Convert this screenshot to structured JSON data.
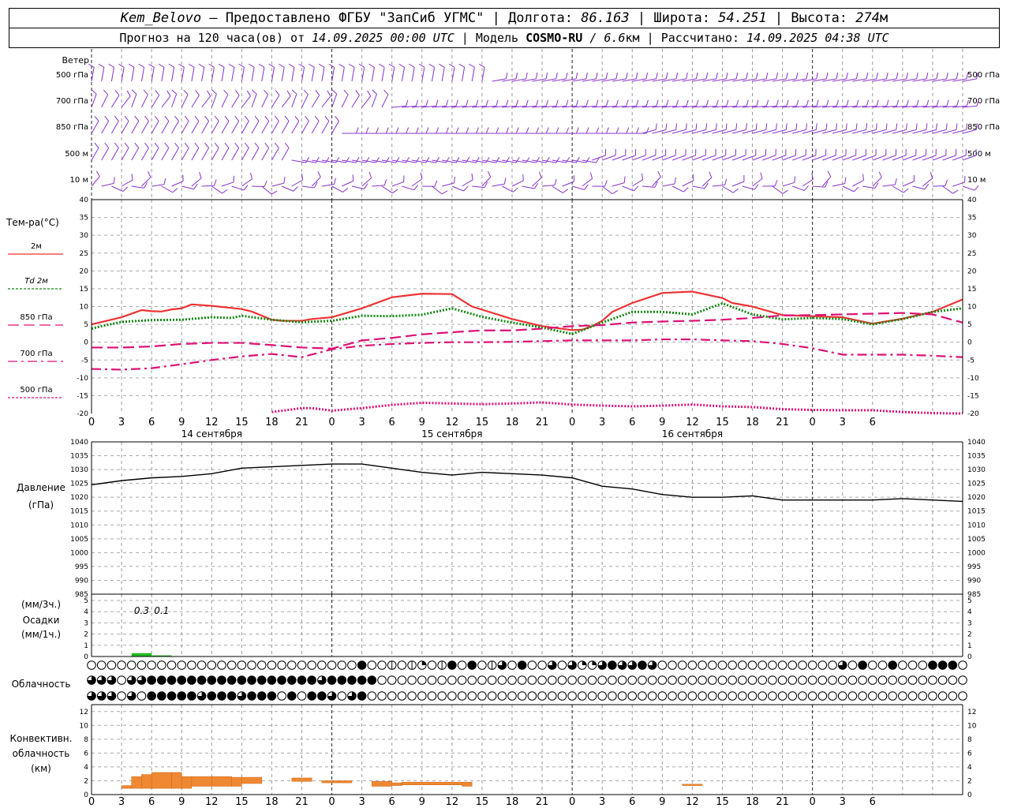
{
  "header": {
    "station": "Kem_Belovo",
    "provider": "– Предоставлено ФГБУ \"ЗапСиб УГМС\"",
    "lon_label": "Долгота:",
    "lon_value": "86.163",
    "lat_label": "Широта:",
    "lat_value": "54.251",
    "alt_label": "Высота:",
    "alt_value": "274",
    "alt_unit": "м",
    "forecast_label": "Прогноз на 120 часа(ов) от",
    "forecast_start": "14.09.2025 00:00 UTC",
    "model_label": "Модель",
    "model_name": "COSMO-RU",
    "model_res": "/ 6.6",
    "model_res_unit": "км",
    "calc_label": "Рассчитано:",
    "calc_time": "14.09.2025 04:38 UTC"
  },
  "chart_data": {
    "type": "meteogram",
    "x_hour_ticks": [
      "0",
      "3",
      "6",
      "9",
      "12",
      "15",
      "18",
      "21",
      "0",
      "3",
      "6",
      "9",
      "12",
      "15",
      "18",
      "21",
      "0",
      "3",
      "6",
      "9",
      "12",
      "15",
      "18",
      "21",
      "0",
      "3",
      "6"
    ],
    "date_labels": [
      "14 сентября",
      "15 сентября",
      "16 сентября"
    ],
    "wind": {
      "label": "Ветер",
      "levels": [
        "500 гПа",
        "700 гПа",
        "850 гПа",
        "500 м",
        "10 м"
      ]
    },
    "temperature": {
      "label": "Тем-ра(°C)",
      "ylim": [
        -20,
        40
      ],
      "yticks": [
        "40",
        "35",
        "30",
        "25",
        "20",
        "15",
        "10",
        "5",
        "0",
        "-5",
        "-10",
        "-15",
        "-20"
      ],
      "series": [
        {
          "name": "2м",
          "color": "#ee3333",
          "style": "solid",
          "x": [
            0,
            3,
            4,
            5,
            6,
            7,
            8,
            9,
            10,
            11,
            12,
            14,
            15,
            16,
            18,
            19,
            20,
            21,
            22,
            24,
            27,
            30,
            33,
            36,
            38,
            42,
            45,
            48,
            49,
            50,
            51,
            52,
            54,
            57,
            60,
            63,
            64,
            66,
            69,
            72,
            75,
            78,
            81,
            84,
            87
          ],
          "values": [
            5,
            7,
            8,
            9,
            8.7,
            8.6,
            9.2,
            9.5,
            10.6,
            10.4,
            10.2,
            9.6,
            9.3,
            8.6,
            6.3,
            6,
            6,
            6,
            6.5,
            7,
            9.5,
            12.6,
            13.6,
            13.5,
            10,
            6.5,
            4.5,
            3.4,
            3.5,
            4.5,
            6,
            8.5,
            11,
            13.8,
            14.2,
            12.4,
            11,
            10,
            7.6,
            7.3,
            7,
            5.2,
            6.6,
            8.5,
            12
          ]
        },
        {
          "name": "Td 2м",
          "color": "#118811",
          "style": "dotted",
          "x": [
            0,
            1,
            3,
            6,
            9,
            12,
            14,
            15,
            18,
            21,
            24,
            27,
            30,
            33,
            36,
            39,
            42,
            45,
            48,
            51,
            54,
            57,
            60,
            63,
            66,
            69,
            72,
            75,
            78,
            81,
            84,
            87
          ],
          "values": [
            3.8,
            4.5,
            5.7,
            6.2,
            6.3,
            7,
            6.8,
            7.4,
            6.3,
            5.6,
            6,
            7.4,
            7.3,
            7.7,
            9.5,
            7.1,
            5.5,
            4.1,
            2.3,
            5.5,
            8.5,
            8.5,
            7.8,
            10.9,
            7.8,
            6.4,
            6.8,
            6.5,
            5,
            6.5,
            8.5,
            9.5
          ]
        },
        {
          "name": "850 гПа",
          "color": "#dd1177",
          "style": "longdash",
          "x": [
            0,
            3,
            6,
            9,
            12,
            15,
            18,
            21,
            24,
            27,
            30,
            33,
            36,
            39,
            42,
            45,
            48,
            51,
            54,
            57,
            60,
            63,
            66,
            69,
            72,
            75,
            78,
            81,
            84,
            87
          ],
          "values": [
            -1.5,
            -1.5,
            -1.2,
            -0.5,
            -0.2,
            -0.2,
            -0.8,
            -1.5,
            -1.8,
            0.5,
            1.2,
            2.2,
            2.8,
            3.3,
            3.3,
            3.8,
            4.5,
            4.8,
            5.5,
            5.8,
            6,
            6.3,
            6.8,
            7.5,
            7.6,
            7.8,
            8,
            8.2,
            7.8,
            5.5
          ]
        },
        {
          "name": "700 гПа",
          "color": "#dd1177",
          "style": "dashdot",
          "x": [
            0,
            3,
            6,
            9,
            12,
            15,
            18,
            21,
            24,
            27,
            30,
            33,
            36,
            39,
            42,
            45,
            48,
            51,
            54,
            57,
            60,
            63,
            66,
            69,
            72,
            75,
            78,
            81,
            84,
            87
          ],
          "values": [
            -7.5,
            -7.7,
            -7.3,
            -6.2,
            -5,
            -4,
            -3.3,
            -4.2,
            -2,
            -1,
            -0.5,
            -0.2,
            0,
            0,
            0.1,
            0.3,
            0.5,
            0.5,
            0.5,
            0.8,
            0.8,
            0.5,
            0.3,
            -0.5,
            -1.7,
            -3.5,
            -3.5,
            -3.5,
            -3.8,
            -4.2
          ]
        },
        {
          "name": "500 гПа",
          "color": "#dd1177",
          "style": "dotted",
          "x": [
            18,
            21,
            22,
            24,
            27,
            30,
            33,
            36,
            39,
            42,
            45,
            48,
            51,
            54,
            57,
            60,
            63,
            66,
            69,
            72,
            75,
            78,
            81,
            84,
            87
          ],
          "values": [
            -19.6,
            -18.5,
            -18.5,
            -19.2,
            -18.5,
            -17.6,
            -17,
            -17.2,
            -17.4,
            -17.2,
            -16.9,
            -17.5,
            -17.8,
            -18,
            -17.8,
            -17.5,
            -18,
            -18.2,
            -18.8,
            -19,
            -19.1,
            -19.1,
            -19.6,
            -19.9,
            -20
          ]
        }
      ]
    },
    "pressure": {
      "label": "Давление",
      "unit": "(гПа)",
      "ylim": [
        985,
        1040
      ],
      "yticks": [
        "1040",
        "1035",
        "1030",
        "1025",
        "1020",
        "1015",
        "1010",
        "1005",
        "1000",
        "995",
        "990",
        "985"
      ],
      "x": [
        0,
        3,
        6,
        9,
        12,
        15,
        18,
        21,
        24,
        27,
        30,
        33,
        36,
        39,
        42,
        45,
        48,
        51,
        54,
        57,
        60,
        63,
        66,
        69,
        72,
        75,
        78,
        81,
        84,
        87
      ],
      "values": [
        1024.5,
        1026,
        1027,
        1027.5,
        1028.5,
        1030.5,
        1031,
        1031.5,
        1032,
        1032,
        1030.5,
        1029,
        1028,
        1029,
        1028.5,
        1028,
        1027,
        1024,
        1023,
        1021,
        1020,
        1020,
        1020.5,
        1019,
        1019,
        1019,
        1019,
        1019.5,
        1019,
        1018.5
      ]
    },
    "precipitation": {
      "label": "Осадки",
      "unit_3h": "(мм/3ч.)",
      "unit_1h": "(мм/1ч.)",
      "ylim": [
        0,
        5
      ],
      "yticks": [
        "5",
        "4",
        "3",
        "2",
        "1",
        "0"
      ],
      "labels": [
        "0.3",
        "0.1"
      ],
      "bars": [
        {
          "x0": 4,
          "x1": 6,
          "value": 0.3
        },
        {
          "x0": 6,
          "x1": 8,
          "value": 0.1
        }
      ]
    },
    "cloudiness": {
      "label": "Облачность",
      "rows": [
        "0000000000000000000000000004001012014040130400303223433430000000000000000003040040004440000203334004000000000000000000",
        "3330334444444444444444434444400000000000000000000000000000000000000000000000000000000000000000000000000000000000400000",
        "3330304444434443444040443034000000000000000000000000000000000000000000000000000000000000000000000000000000000000000000"
      ]
    },
    "convective": {
      "label_lines": [
        "Конвективн.",
        "облачность",
        "(км)"
      ],
      "ylim": [
        0,
        13
      ],
      "yticks": [
        "12",
        "10",
        "8",
        "6",
        "4",
        "2",
        "0"
      ],
      "color": "#ee8833",
      "bars": [
        {
          "x0": 3,
          "x1": 4,
          "bottom": 0.9,
          "top": 1.3
        },
        {
          "x0": 4,
          "x1": 5,
          "bottom": 0.9,
          "top": 2.6
        },
        {
          "x0": 5,
          "x1": 6,
          "bottom": 0.9,
          "top": 2.9
        },
        {
          "x0": 6,
          "x1": 8,
          "bottom": 0.9,
          "top": 3.2
        },
        {
          "x0": 8,
          "x1": 9,
          "bottom": 0.9,
          "top": 3.2
        },
        {
          "x0": 9,
          "x1": 10,
          "bottom": 0.9,
          "top": 2.6
        },
        {
          "x0": 10,
          "x1": 12,
          "bottom": 1.2,
          "top": 2.6
        },
        {
          "x0": 12,
          "x1": 14,
          "bottom": 1.2,
          "top": 2.6
        },
        {
          "x0": 14,
          "x1": 15,
          "bottom": 1.2,
          "top": 2.5
        },
        {
          "x0": 15,
          "x1": 17,
          "bottom": 1.6,
          "top": 2.5
        },
        {
          "x0": 20,
          "x1": 22,
          "bottom": 1.9,
          "top": 2.4
        },
        {
          "x0": 23,
          "x1": 26,
          "bottom": 1.7,
          "top": 2.0
        },
        {
          "x0": 28,
          "x1": 30,
          "bottom": 1.2,
          "top": 1.9
        },
        {
          "x0": 30,
          "x1": 31,
          "bottom": 1.3,
          "top": 1.7
        },
        {
          "x0": 31,
          "x1": 37,
          "bottom": 1.4,
          "top": 1.8
        },
        {
          "x0": 37,
          "x1": 38,
          "bottom": 1.2,
          "top": 1.8
        },
        {
          "x0": 59,
          "x1": 61,
          "bottom": 1.3,
          "top": 1.5
        }
      ]
    }
  }
}
